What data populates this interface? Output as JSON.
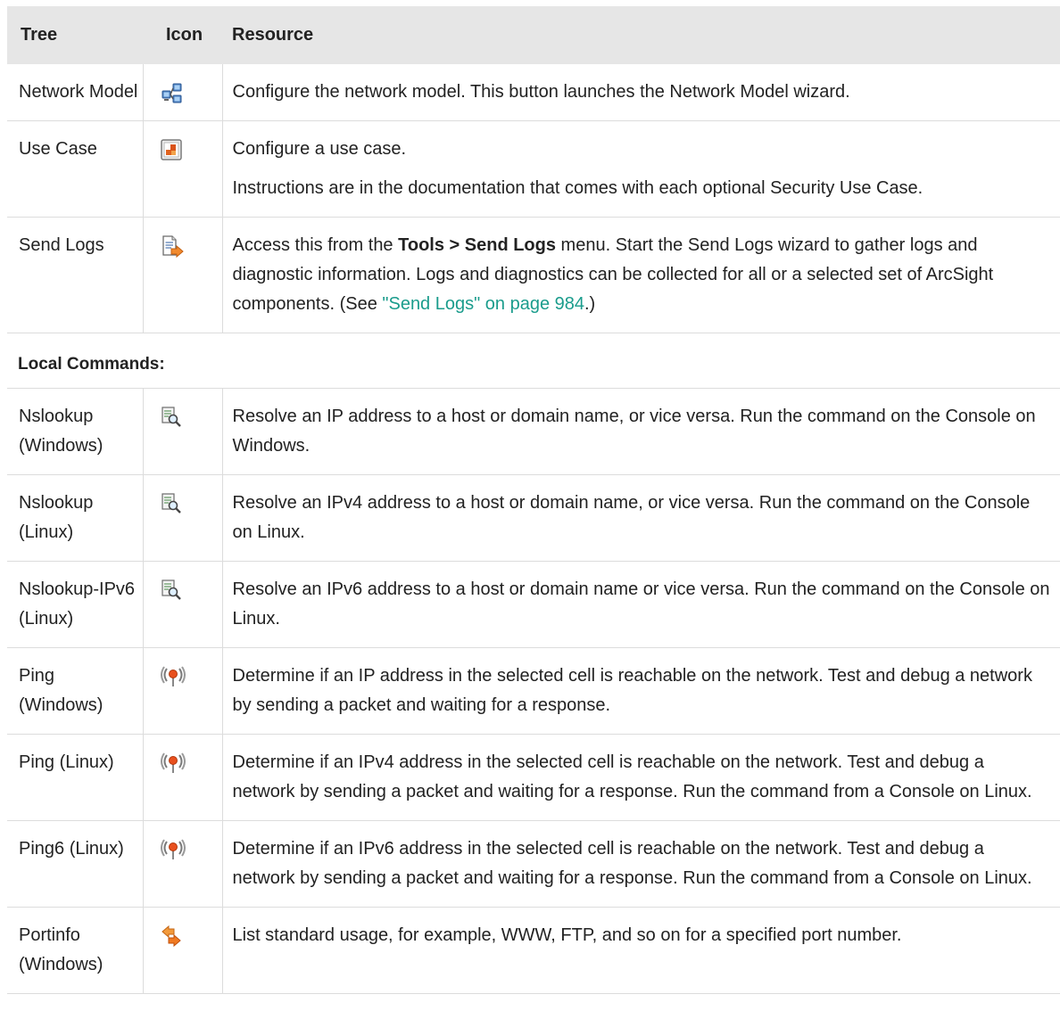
{
  "headers": {
    "tree": "Tree",
    "icon": "Icon",
    "resource": "Resource"
  },
  "rows": [
    {
      "tree": "Network Model",
      "icon": "network-model-icon",
      "resource": [
        "Configure the network model. This button launches the Network Model wizard."
      ]
    },
    {
      "tree": "Use Case",
      "icon": "use-case-icon",
      "resource": [
        "Configure a use case.",
        "Instructions are in the documentation that comes with each optional Security Use Case."
      ]
    },
    {
      "tree": "Send Logs",
      "icon": "send-logs-icon",
      "resource_parts": {
        "before": "Access this from the ",
        "bold": "Tools > Send Logs",
        "after": " menu. Start the Send Logs wizard to gather logs and diagnostic information. Logs and diagnostics can be collected for all or a selected set of ArcSight components. (See ",
        "link": "\"Send Logs\" on page 984",
        "end": ".)"
      }
    }
  ],
  "section_label": "Local Commands:",
  "commands": [
    {
      "tree": "Nslookup (Windows)",
      "icon": "nslookup-icon",
      "resource": "Resolve an IP address to a host or domain name, or vice versa. Run the command on the Console on Windows."
    },
    {
      "tree": "Nslookup (Linux)",
      "icon": "nslookup-icon",
      "resource": "Resolve an IPv4 address to a host or domain name, or vice versa. Run the command on the Console on Linux."
    },
    {
      "tree": "Nslookup-IPv6 (Linux)",
      "icon": "nslookup-icon",
      "resource": "Resolve an IPv6 address to a host or domain name or vice versa. Run the command on the Console on Linux."
    },
    {
      "tree": "Ping (Windows)",
      "icon": "ping-icon",
      "resource": "Determine if an IP address in the selected cell is reachable on the network. Test and debug a network by sending a packet and waiting for a response."
    },
    {
      "tree": "Ping (Linux)",
      "icon": "ping-icon",
      "resource": "Determine if an IPv4 address in the selected cell is reachable on the network. Test and debug a network by sending a packet and waiting for a response. Run the command from a Console on Linux."
    },
    {
      "tree": "Ping6 (Linux)",
      "icon": "ping-icon",
      "resource": "Determine if an IPv6 address in the selected cell is reachable on the network. Test and debug a network by sending a packet and waiting for a response. Run the command from a Console on Linux."
    },
    {
      "tree": "Portinfo (Windows)",
      "icon": "portinfo-icon",
      "resource": "List standard usage, for example, WWW, FTP, and so on for a specified port number."
    }
  ],
  "colors": {
    "header_bg": "#e6e6e6",
    "link": "#1a9c8c",
    "border": "#dcdcdc"
  }
}
